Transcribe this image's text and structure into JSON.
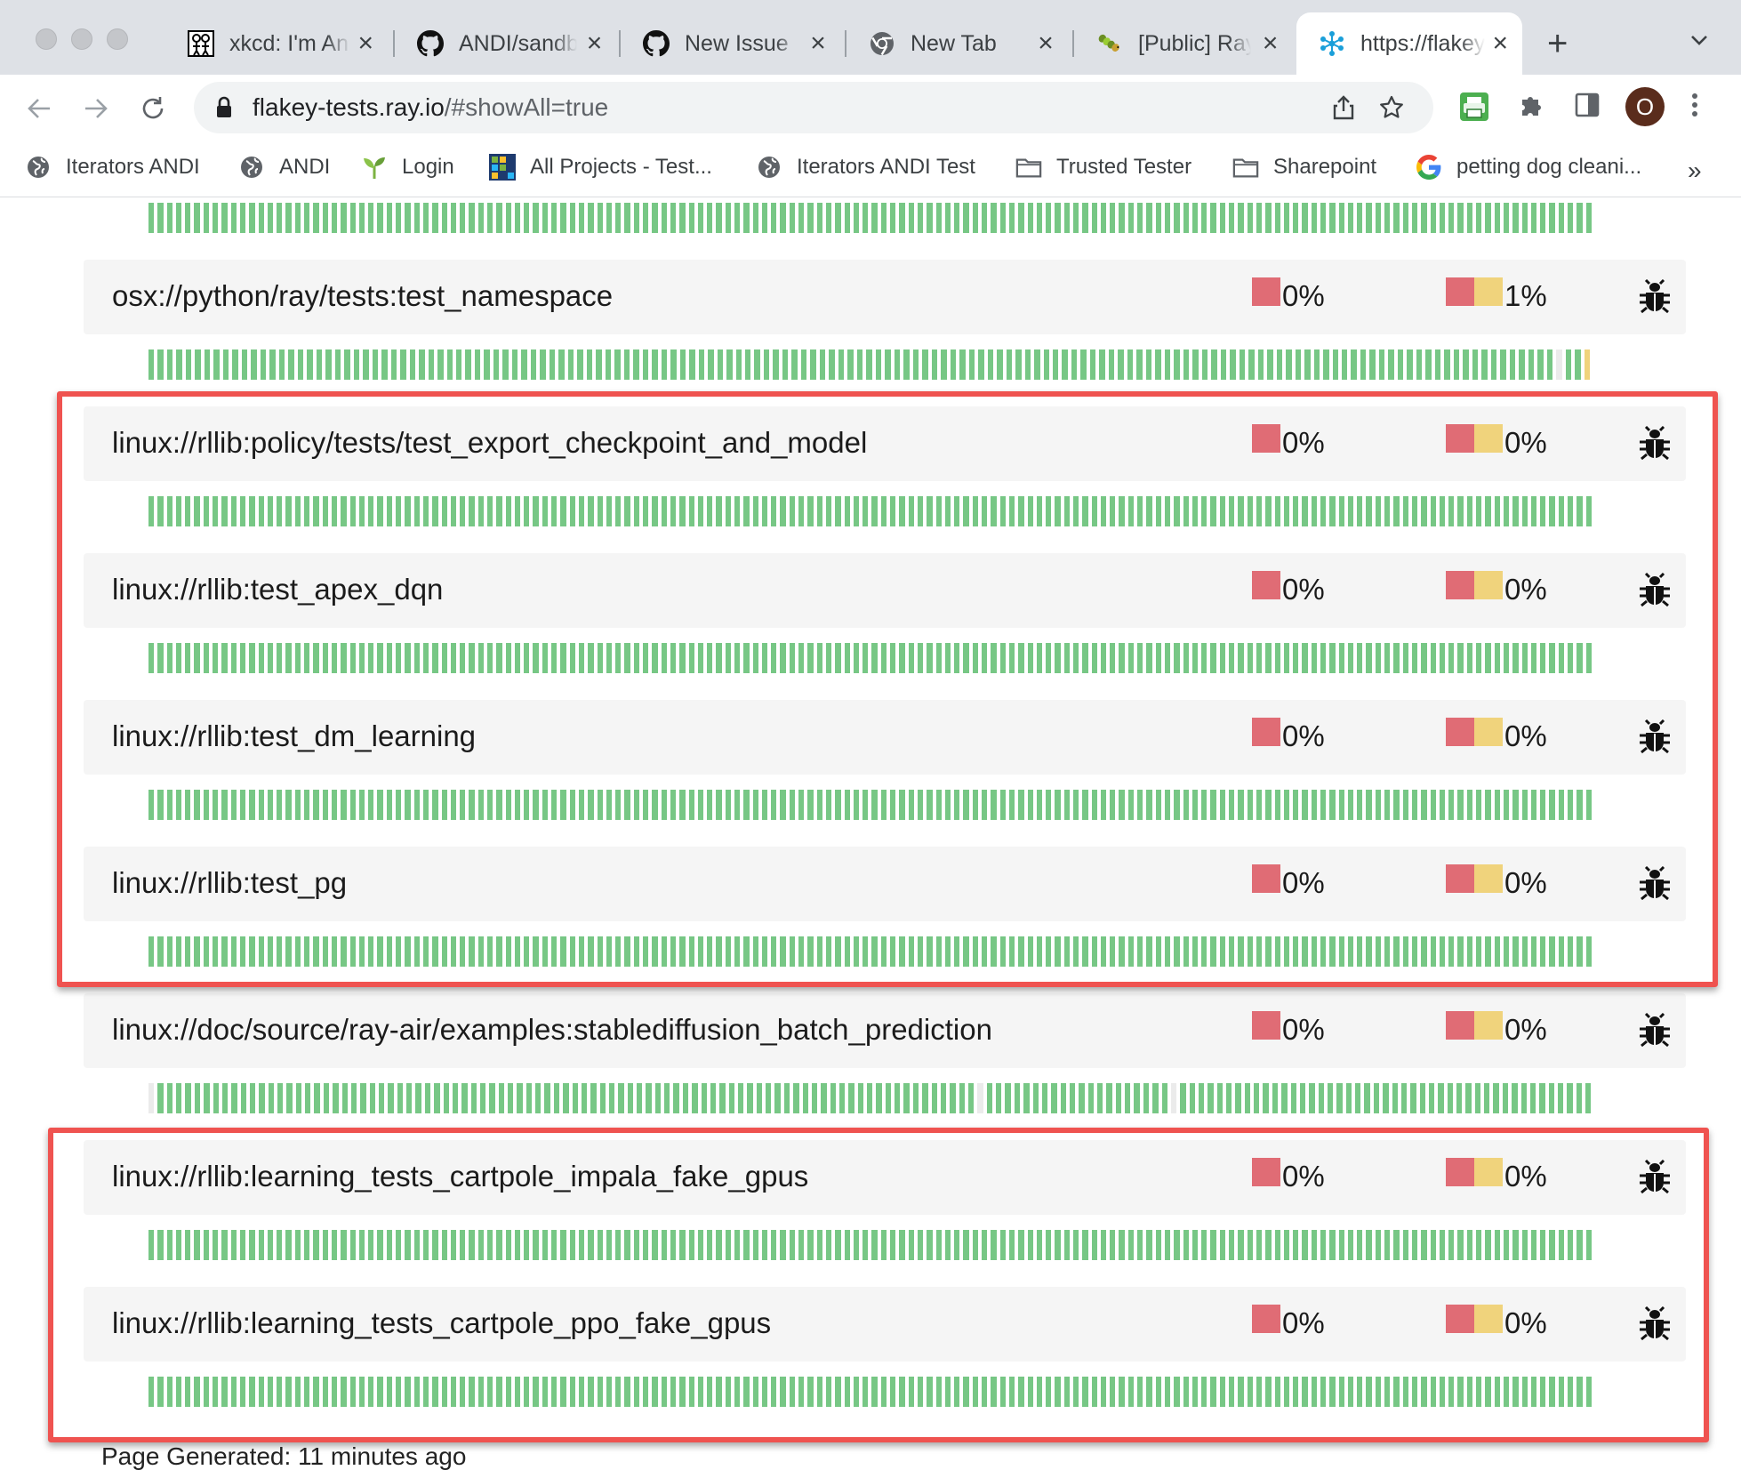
{
  "browser": {
    "tabs": [
      {
        "title": "xkcd: I'm An Engineer",
        "icon": "xkcd-icon"
      },
      {
        "title": "ANDI/sandbox",
        "icon": "github-icon"
      },
      {
        "title": "New Issue",
        "icon": "github-icon"
      },
      {
        "title": "New Tab",
        "icon": "chrome-icon"
      },
      {
        "title": "[Public] Ray",
        "icon": "caterpillar-icon"
      },
      {
        "title": "https://flakey-tests.ray.io",
        "icon": "ray-icon",
        "active": true
      }
    ],
    "url_host": "flakey-tests.ray.io",
    "url_rest": "/#showAll=true",
    "profile_initial": "O",
    "bookmarks": [
      {
        "label": "Iterators ANDI",
        "icon": "globe-icon"
      },
      {
        "label": "ANDI",
        "icon": "globe-icon"
      },
      {
        "label": "Login",
        "icon": "sprout-icon"
      },
      {
        "label": "All Projects - Test...",
        "icon": "grid-icon"
      },
      {
        "label": "Iterators ANDI Test",
        "icon": "globe-icon"
      },
      {
        "label": "Trusted Tester",
        "icon": "folder-icon"
      },
      {
        "label": "Sharepoint",
        "icon": "folder-icon"
      },
      {
        "label": "petting dog cleani...",
        "icon": "google-icon"
      }
    ],
    "bookmarks_more": "»"
  },
  "colors": {
    "pass": "#77c785",
    "fail": "#e06c75",
    "flaky": "#f0d37c",
    "empty": "#ebebeb",
    "highlight": "#ef5350"
  },
  "tests": [
    {
      "name": "osx://python/ray/tests:test_namespace",
      "fail_rate": "0%",
      "flaky_rate": "1%",
      "history": "pppppppppppppppppppppppppppppppppppppppppppppppppppppppppppppppppppppppppppppppppppppppppppppppppppppppppppppppppppppppppppppppppppppppppppppppppppppppeppf"
    },
    {
      "name": "linux://rllib:policy/tests/test_export_checkpoint_and_model",
      "fail_rate": "0%",
      "flaky_rate": "0%",
      "history": "pppppppppppppppppppppppppppppppppppppppppppppppppppppppppppppppppppppppppppppppppppppppppppppppppppppppppppppppppppppppppppppppppppppppppppppppppppppppppppppp"
    },
    {
      "name": "linux://rllib:test_apex_dqn",
      "fail_rate": "0%",
      "flaky_rate": "0%",
      "history": "pppppppppppppppppppppppppppppppppppppppppppppppppppppppppppppppppppppppppppppppppppppppppppppppppppppppppppppppppppppppppppppppppppppppppppppppppppppppppppppp"
    },
    {
      "name": "linux://rllib:test_dm_learning",
      "fail_rate": "0%",
      "flaky_rate": "0%",
      "history": "pppppppppppppppppppppppppppppppppppppppppppppppppppppppppppppppppppppppppppppppppppppppppppppppppppppppppppppppppppppppppppppppppppppppppppppppppppppppppppppp"
    },
    {
      "name": "linux://rllib:test_pg",
      "fail_rate": "0%",
      "flaky_rate": "0%",
      "history": "pppppppppppppppppppppppppppppppppppppppppppppppppppppppppppppppppppppppppppppppppppppppppppppppppppppppppppppppppppppppppppppppppppppppppppppppppppppppppppppp"
    },
    {
      "name": "linux://doc/source/ray-air/examples:stablediffusion_batch_prediction",
      "fail_rate": "0%",
      "flaky_rate": "0%",
      "history": "epppppppppppppppppppppppppppppppppppppppppppppppppppppppppppppppppppppppppppppppppppppppppeppppppppppppppppppppeppppppppppppppppppppppppppppppppppppppppppppp"
    },
    {
      "name": "linux://rllib:learning_tests_cartpole_impala_fake_gpus",
      "fail_rate": "0%",
      "flaky_rate": "0%",
      "history": "pppppppppppppppppppppppppppppppppppppppppppppppppppppppppppppppppppppppppppppppppppppppppppppppppppppppppppppppppppppppppppppppppppppppppppppppppppppppppppppp"
    },
    {
      "name": "linux://rllib:learning_tests_cartpole_ppo_fake_gpus",
      "fail_rate": "0%",
      "flaky_rate": "0%",
      "history": "pppppppppppppppppppppppppppppppppppppppppppppppppppppppppppppppppppppppppppppppppppppppppppppppppppppppppppppppppppppppppppppppppppppppppppppppppppppppppppppp"
    }
  ],
  "top_partial_history": "pppppppppppppppppppppppppppppppppppppppppppppppppppppppppppppppppppppppppppppppppppppppppppppppppppppppppppppppppppppppppppppppppppppppppppppppppppppppppppppp",
  "footer": "Page Generated: 11 minutes ago"
}
